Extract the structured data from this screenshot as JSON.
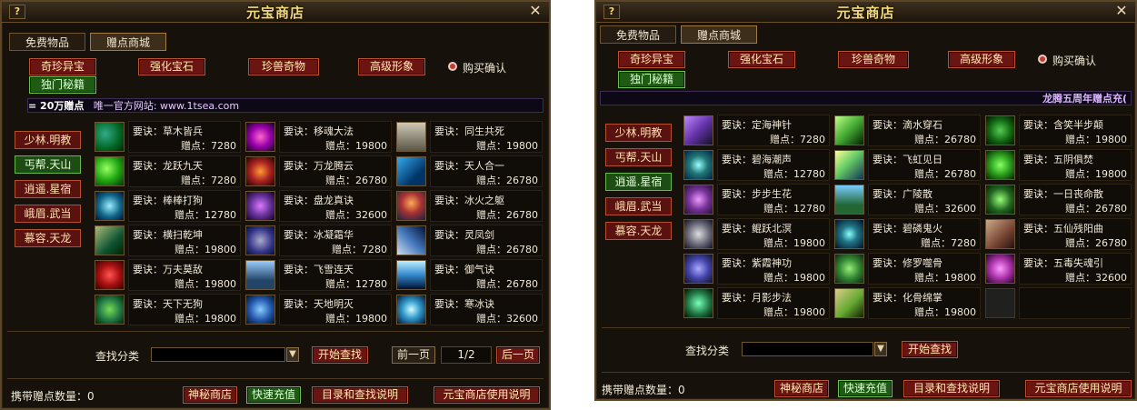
{
  "left": {
    "title": "元宝商店",
    "tabs": [
      "免费物品",
      "赠点商城"
    ],
    "categories": [
      "奇珍异宝",
      "强化宝石",
      "珍兽奇物",
      "高级形象"
    ],
    "category_green": "独门秘籍",
    "confirm_label": "购买确认",
    "marquee": {
      "prefix": "= 20万赠点",
      "text": "唯一官方网站: www.1tsea.com"
    },
    "sects": [
      {
        "label": "少林.明教",
        "color": "red"
      },
      {
        "label": "丐帮.天山",
        "color": "green"
      },
      {
        "label": "逍遥.星宿",
        "color": "red"
      },
      {
        "label": "峨眉.武当",
        "color": "red"
      },
      {
        "label": "慕容.天龙",
        "color": "red"
      }
    ],
    "items": [
      {
        "name": "要诀：草木皆兵",
        "price": "赠点：7280"
      },
      {
        "name": "要诀：移魂大法",
        "price": "赠点：19800"
      },
      {
        "name": "要诀：同生共死",
        "price": "赠点：19800"
      },
      {
        "name": "要诀：龙跃九天",
        "price": "赠点：7280"
      },
      {
        "name": "要诀：万龙腾云",
        "price": "赠点：26780"
      },
      {
        "name": "要诀：天人合一",
        "price": "赠点：26780"
      },
      {
        "name": "要诀：棒棒打狗",
        "price": "赠点：12780"
      },
      {
        "name": "要诀：盘龙真诀",
        "price": "赠点：32600"
      },
      {
        "name": "要诀：冰火之躯",
        "price": "赠点：26780"
      },
      {
        "name": "要诀：横扫乾坤",
        "price": "赠点：19800"
      },
      {
        "name": "要诀：冰凝霜华",
        "price": "赠点：7280"
      },
      {
        "name": "要诀：灵凤剑",
        "price": "赠点：26780"
      },
      {
        "name": "要诀：万夫莫敌",
        "price": "赠点：19800"
      },
      {
        "name": "要诀：飞雪连天",
        "price": "赠点：12780"
      },
      {
        "name": "要诀：御气诀",
        "price": "赠点：26780"
      },
      {
        "name": "要诀：天下无狗",
        "price": "赠点：19800"
      },
      {
        "name": "要诀：天地明灭",
        "price": "赠点：19800"
      },
      {
        "name": "要诀：寒冰诀",
        "price": "赠点：32600"
      }
    ],
    "search_label": "查找分类",
    "search_button": "开始查找",
    "prev_page": "前一页",
    "page": "1/2",
    "next_page": "后一页",
    "footer": {
      "balance": "携带赠点数量：0",
      "buttons": [
        "神秘商店",
        "快速充值",
        "目录和查找说明",
        "元宝商店使用说明"
      ]
    }
  },
  "right": {
    "title": "元宝商店",
    "tabs": [
      "免费物品",
      "赠点商城"
    ],
    "categories": [
      "奇珍异宝",
      "强化宝石",
      "珍兽奇物",
      "高级形象"
    ],
    "category_green": "独门秘籍",
    "confirm_label": "购买确认",
    "marquee": {
      "text": "龙腾五周年赠点充("
    },
    "sects": [
      {
        "label": "少林.明教",
        "color": "red"
      },
      {
        "label": "丐帮.天山",
        "color": "red"
      },
      {
        "label": "逍遥.星宿",
        "color": "green"
      },
      {
        "label": "峨眉.武当",
        "color": "red"
      },
      {
        "label": "慕容.天龙",
        "color": "red"
      }
    ],
    "items": [
      {
        "name": "要诀：定海神针",
        "price": "赠点：7280"
      },
      {
        "name": "要诀：滴水穿石",
        "price": "赠点：26780"
      },
      {
        "name": "要诀：含笑半步颠",
        "price": "赠点：19800"
      },
      {
        "name": "要诀：碧海潮声",
        "price": "赠点：12780"
      },
      {
        "name": "要诀：飞虹见日",
        "price": "赠点：26780"
      },
      {
        "name": "要诀：五阴俱焚",
        "price": "赠点：19800"
      },
      {
        "name": "要诀：步步生花",
        "price": "赠点：12780"
      },
      {
        "name": "要诀：广陵散",
        "price": "赠点：32600"
      },
      {
        "name": "要诀：一日丧命散",
        "price": "赠点：26780"
      },
      {
        "name": "要诀：鲲跃北溟",
        "price": "赠点：19800"
      },
      {
        "name": "要诀：碧磷鬼火",
        "price": "赠点：7280"
      },
      {
        "name": "要诀：五仙残阳曲",
        "price": "赠点：26780"
      },
      {
        "name": "要诀：紫霞神功",
        "price": "赠点：19800"
      },
      {
        "name": "要诀：修罗噬骨",
        "price": "赠点：19800"
      },
      {
        "name": "要诀：五毒失魂引",
        "price": "赠点：32600"
      },
      {
        "name": "要诀：月影步法",
        "price": "赠点：19800"
      },
      {
        "name": "要诀：化骨绵掌",
        "price": "赠点：19800"
      }
    ],
    "search_label": "查找分类",
    "search_button": "开始查找",
    "footer": {
      "balance": "携带赠点数量：0",
      "buttons": [
        "神秘商店",
        "快速充值",
        "目录和查找说明",
        "元宝商店使用说明"
      ]
    }
  }
}
